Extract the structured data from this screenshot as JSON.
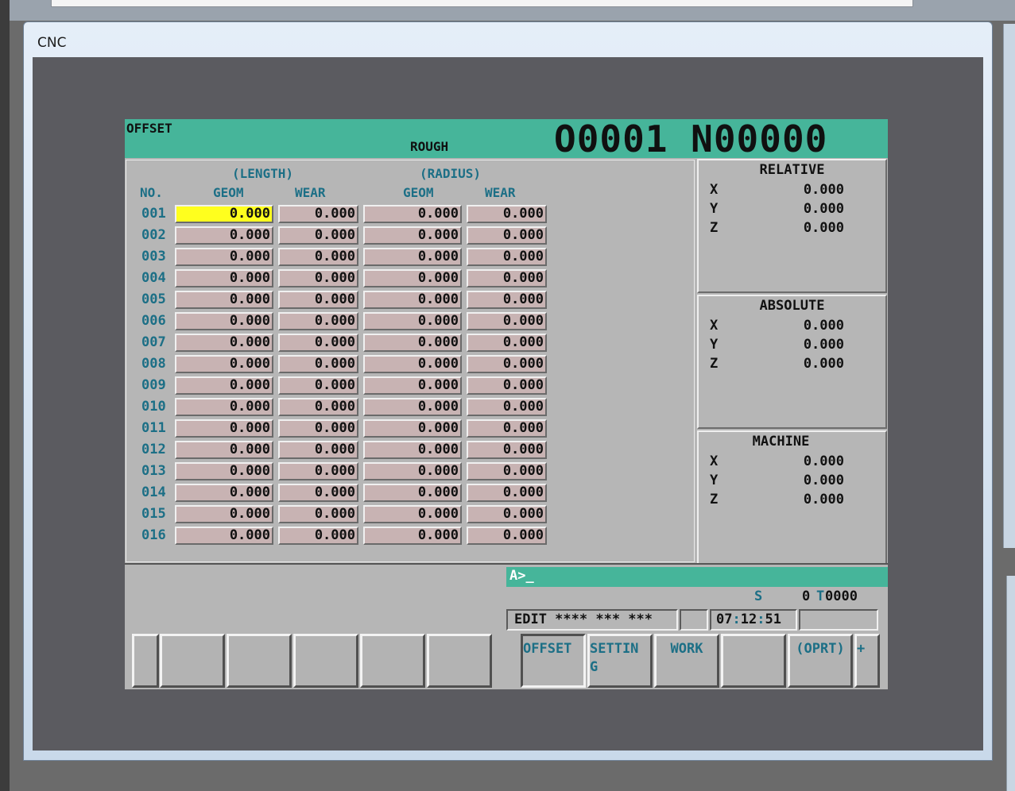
{
  "window": {
    "title": "CNC"
  },
  "header": {
    "title": "OFFSET",
    "mode": "ROUGH",
    "program": "O0001 N00000"
  },
  "offset_table": {
    "length_caption": "(LENGTH)",
    "radius_caption": "(RADIUS)",
    "col_no": "NO.",
    "col_length_geom": "GEOM",
    "col_length_wear": "WEAR",
    "col_radius_geom": "GEOM",
    "col_radius_wear": "WEAR",
    "selected_row": 0,
    "selected_col": 0,
    "rows": [
      {
        "no": "001",
        "length_geom": "0.000",
        "length_wear": "0.000",
        "radius_geom": "0.000",
        "radius_wear": "0.000"
      },
      {
        "no": "002",
        "length_geom": "0.000",
        "length_wear": "0.000",
        "radius_geom": "0.000",
        "radius_wear": "0.000"
      },
      {
        "no": "003",
        "length_geom": "0.000",
        "length_wear": "0.000",
        "radius_geom": "0.000",
        "radius_wear": "0.000"
      },
      {
        "no": "004",
        "length_geom": "0.000",
        "length_wear": "0.000",
        "radius_geom": "0.000",
        "radius_wear": "0.000"
      },
      {
        "no": "005",
        "length_geom": "0.000",
        "length_wear": "0.000",
        "radius_geom": "0.000",
        "radius_wear": "0.000"
      },
      {
        "no": "006",
        "length_geom": "0.000",
        "length_wear": "0.000",
        "radius_geom": "0.000",
        "radius_wear": "0.000"
      },
      {
        "no": "007",
        "length_geom": "0.000",
        "length_wear": "0.000",
        "radius_geom": "0.000",
        "radius_wear": "0.000"
      },
      {
        "no": "008",
        "length_geom": "0.000",
        "length_wear": "0.000",
        "radius_geom": "0.000",
        "radius_wear": "0.000"
      },
      {
        "no": "009",
        "length_geom": "0.000",
        "length_wear": "0.000",
        "radius_geom": "0.000",
        "radius_wear": "0.000"
      },
      {
        "no": "010",
        "length_geom": "0.000",
        "length_wear": "0.000",
        "radius_geom": "0.000",
        "radius_wear": "0.000"
      },
      {
        "no": "011",
        "length_geom": "0.000",
        "length_wear": "0.000",
        "radius_geom": "0.000",
        "radius_wear": "0.000"
      },
      {
        "no": "012",
        "length_geom": "0.000",
        "length_wear": "0.000",
        "radius_geom": "0.000",
        "radius_wear": "0.000"
      },
      {
        "no": "013",
        "length_geom": "0.000",
        "length_wear": "0.000",
        "radius_geom": "0.000",
        "radius_wear": "0.000"
      },
      {
        "no": "014",
        "length_geom": "0.000",
        "length_wear": "0.000",
        "radius_geom": "0.000",
        "radius_wear": "0.000"
      },
      {
        "no": "015",
        "length_geom": "0.000",
        "length_wear": "0.000",
        "radius_geom": "0.000",
        "radius_wear": "0.000"
      },
      {
        "no": "016",
        "length_geom": "0.000",
        "length_wear": "0.000",
        "radius_geom": "0.000",
        "radius_wear": "0.000"
      }
    ]
  },
  "positions": {
    "relative": {
      "title": "RELATIVE",
      "axes": [
        {
          "axis": "X",
          "value": "0.000"
        },
        {
          "axis": "Y",
          "value": "0.000"
        },
        {
          "axis": "Z",
          "value": "0.000"
        }
      ]
    },
    "absolute": {
      "title": "ABSOLUTE",
      "axes": [
        {
          "axis": "X",
          "value": "0.000"
        },
        {
          "axis": "Y",
          "value": "0.000"
        },
        {
          "axis": "Z",
          "value": "0.000"
        }
      ]
    },
    "machine": {
      "title": "MACHINE",
      "axes": [
        {
          "axis": "X",
          "value": "0.000"
        },
        {
          "axis": "Y",
          "value": "0.000"
        },
        {
          "axis": "Z",
          "value": "0.000"
        }
      ]
    }
  },
  "input_line": {
    "prompt": "A>_"
  },
  "status": {
    "s_label": "S",
    "s_value": "0",
    "t_label": "T",
    "t_value": "0000",
    "mode_text": "EDIT **** *** ***",
    "blank_box": "",
    "clock_h": "07",
    "clock_m": "12",
    "clock_s": "51",
    "clock_sep": ":",
    "extra_box": ""
  },
  "softkeys": {
    "left": [
      "",
      "",
      "",
      "",
      "",
      ""
    ],
    "right": [
      {
        "label": "OFFSET",
        "active": true
      },
      {
        "label": "SETTIN\nG",
        "active": false
      },
      {
        "label": "WORK",
        "active": false
      },
      {
        "label": "",
        "active": false
      },
      {
        "label": "(OPRT)",
        "active": false
      },
      {
        "label": "+",
        "active": false
      }
    ]
  }
}
